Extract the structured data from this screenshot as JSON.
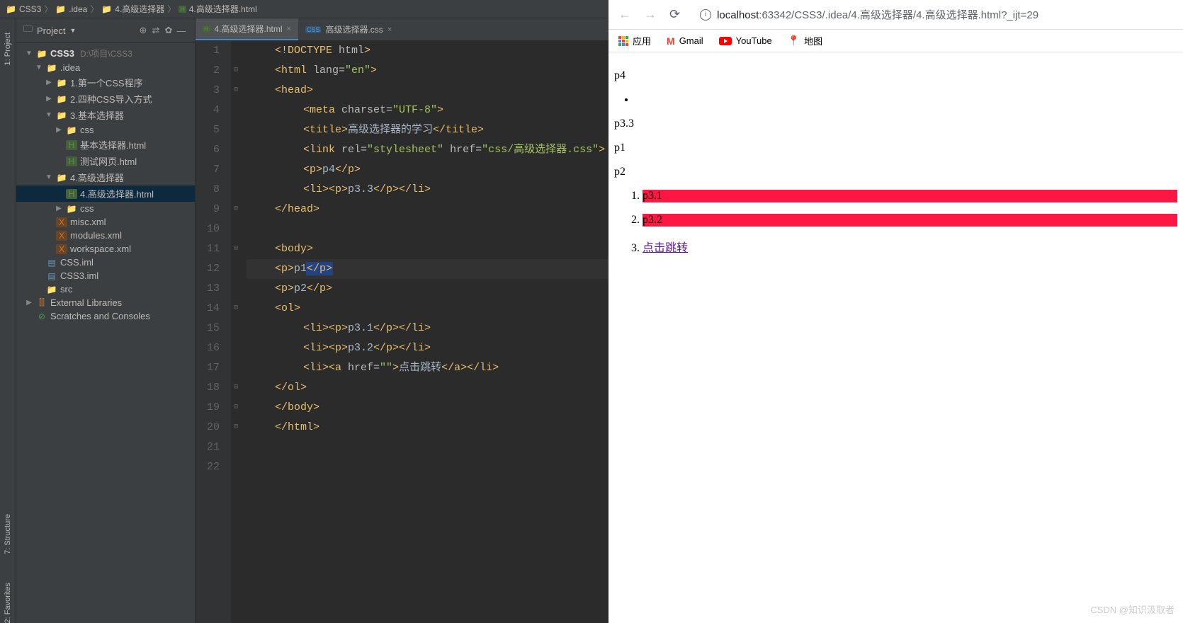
{
  "breadcrumb": [
    "CSS3",
    ".idea",
    "4.高级选择器",
    "4.高级选择器.html"
  ],
  "projectPanel": {
    "title": "Project"
  },
  "tree": {
    "root": {
      "label": "CSS3",
      "path": "D:\\项目\\CSS3"
    },
    "idea": ".idea",
    "f1": "1.第一个CSS程序",
    "f2": "2.四种CSS导入方式",
    "f3": "3.基本选择器",
    "f3_css": "css",
    "f3_html1": "基本选择器.html",
    "f3_html2": "测试网页.html",
    "f4": "4.高级选择器",
    "f4_html": "4.高级选择器.html",
    "f4_css": "css",
    "misc": "misc.xml",
    "modules": "modules.xml",
    "workspace": "workspace.xml",
    "cssiml": "CSS.iml",
    "css3iml": "CSS3.iml",
    "src": "src",
    "extLib": "External Libraries",
    "scratches": "Scratches and Consoles"
  },
  "tabs": {
    "t1": "4.高级选择器.html",
    "t2": "高级选择器.css"
  },
  "leftTabs": {
    "project": "1: Project",
    "structure": "7: Structure",
    "favorites": "2: Favorites"
  },
  "code": {
    "l1_a": "<!DOCTYPE ",
    "l1_b": "html",
    "l1_c": ">",
    "l2_a": "<html ",
    "l2_b": "lang=",
    "l2_c": "\"en\"",
    "l2_d": ">",
    "l3": "<head>",
    "l4_a": "<meta ",
    "l4_b": "charset=",
    "l4_c": "\"UTF-8\"",
    "l4_d": ">",
    "l5_a": "<title>",
    "l5_b": "高级选择器的学习",
    "l5_c": "</title>",
    "l6_a": "<link ",
    "l6_b": "rel=",
    "l6_c": "\"stylesheet\" ",
    "l6_d": "href=",
    "l6_e": "\"css/高级选择器.css\"",
    "l6_f": ">",
    "l7_a": "<p>",
    "l7_b": "p4",
    "l7_c": "</p>",
    "l8_a": "<li><p>",
    "l8_b": "p3.3",
    "l8_c": "</p></li>",
    "l9": "</head>",
    "l11": "<body>",
    "l12_a": "<p>",
    "l12_b": "p1",
    "l12_c": "</p>",
    "l13_a": "<p>",
    "l13_b": "p2",
    "l13_c": "</p>",
    "l14": "<ol>",
    "l15_a": "<li><p>",
    "l15_b": "p3.1",
    "l15_c": "</p></li>",
    "l16_a": "<li><p>",
    "l16_b": "p3.2",
    "l16_c": "</p></li>",
    "l17_a": "<li><a ",
    "l17_b": "href=",
    "l17_c": "\"\"",
    "l17_d": ">",
    "l17_e": "点击跳转",
    "l17_f": "</a></li>",
    "l18": "</ol>",
    "l19": "</body>",
    "l20": "</html>"
  },
  "browser": {
    "url_host": "localhost",
    "url_path": ":63342/CSS3/.idea/4.高级选择器/4.高级选择器.html?_ijt=29",
    "bookmarks": {
      "apps": "应用",
      "gmail": "Gmail",
      "youtube": "YouTube",
      "maps": "地图"
    },
    "page": {
      "p4": "p4",
      "p33": "p3.3",
      "p1": "p1",
      "p2": "p2",
      "li1": "p3.1",
      "li2": "p3.2",
      "li3": "点击跳转"
    }
  },
  "watermark": "CSDN @知识汲取者"
}
